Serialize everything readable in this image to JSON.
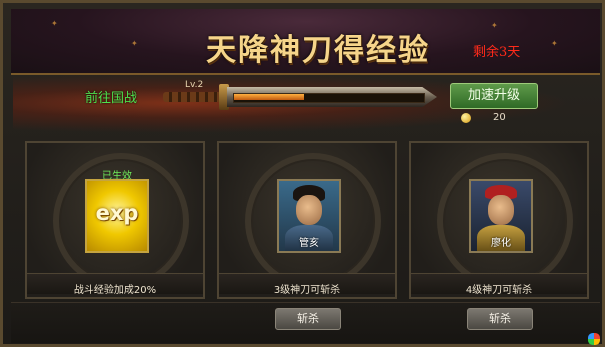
{
  "header": {
    "title": "天降神刀得经验",
    "days_left": "剩余3天"
  },
  "upgrade": {
    "goto_label": "前往国战",
    "level_label": "Lv.2",
    "progress": 0.37,
    "speed_button": "加速升级",
    "cost": "20"
  },
  "panels": [
    {
      "kind": "exp",
      "card_text": "exp",
      "status": "已生效",
      "caption": "战斗经验加成20%"
    },
    {
      "kind": "hero",
      "hero_name": "管亥",
      "caption": "3级神刀可斩杀",
      "button": "斩杀"
    },
    {
      "kind": "hero",
      "hero_name": "廖化",
      "caption": "4级神刀可斩杀",
      "button": "斩杀"
    }
  ],
  "icons": {
    "coin": "coin-icon",
    "exp": "exp-icon",
    "logo": "app-logo-icon"
  },
  "colors": {
    "progress": "#ff9a2a",
    "status_green": "#6eea5a",
    "days_red": "#ff2a1a",
    "title_gold": "#f6d58a"
  }
}
